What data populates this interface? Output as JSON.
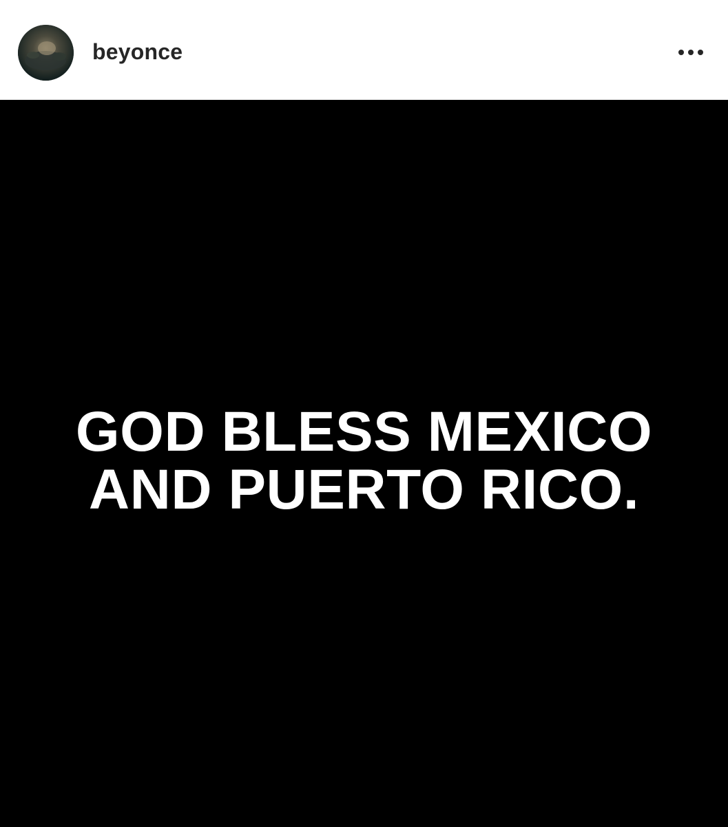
{
  "post": {
    "username": "beyonce",
    "avatar_icon": "profile-photo",
    "more_icon": "more-options-icon",
    "image_text": {
      "line1": "GOD BLESS MEXICO",
      "line2": "AND PUERTO RICO."
    },
    "image_background_color": "#000000",
    "image_text_color": "#ffffff"
  }
}
